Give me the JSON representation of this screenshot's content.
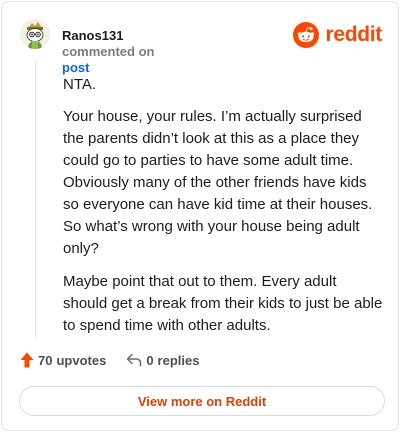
{
  "header": {
    "username": "Ranos131",
    "action_text": "commented on",
    "post_link": "post",
    "brand": "reddit",
    "avatar_icon": "snoo-avatar-icon",
    "logo_icon": "reddit-logo-icon"
  },
  "comment": {
    "paragraphs": [
      "NTA.",
      "Your house, your rules. I’m actually surprised the parents didn’t look at this as a place they could go to parties to have some adult time. Obviously many of the other friends have kids so everyone can have kid time at their houses. So what’s wrong with your house being adult only?",
      "Maybe point that out to them. Every adult should get a break from their kids to just be able to spend time with other adults."
    ]
  },
  "footer": {
    "upvotes": {
      "count": "70",
      "label": "upvotes",
      "icon": "upvote-arrow-icon"
    },
    "replies": {
      "count": "0",
      "label": "replies",
      "icon": "reply-icon"
    },
    "view_more": "View more on Reddit"
  },
  "colors": {
    "brand": "#ff4500",
    "link": "#0a66d6",
    "view_more_text": "#e03e00"
  }
}
